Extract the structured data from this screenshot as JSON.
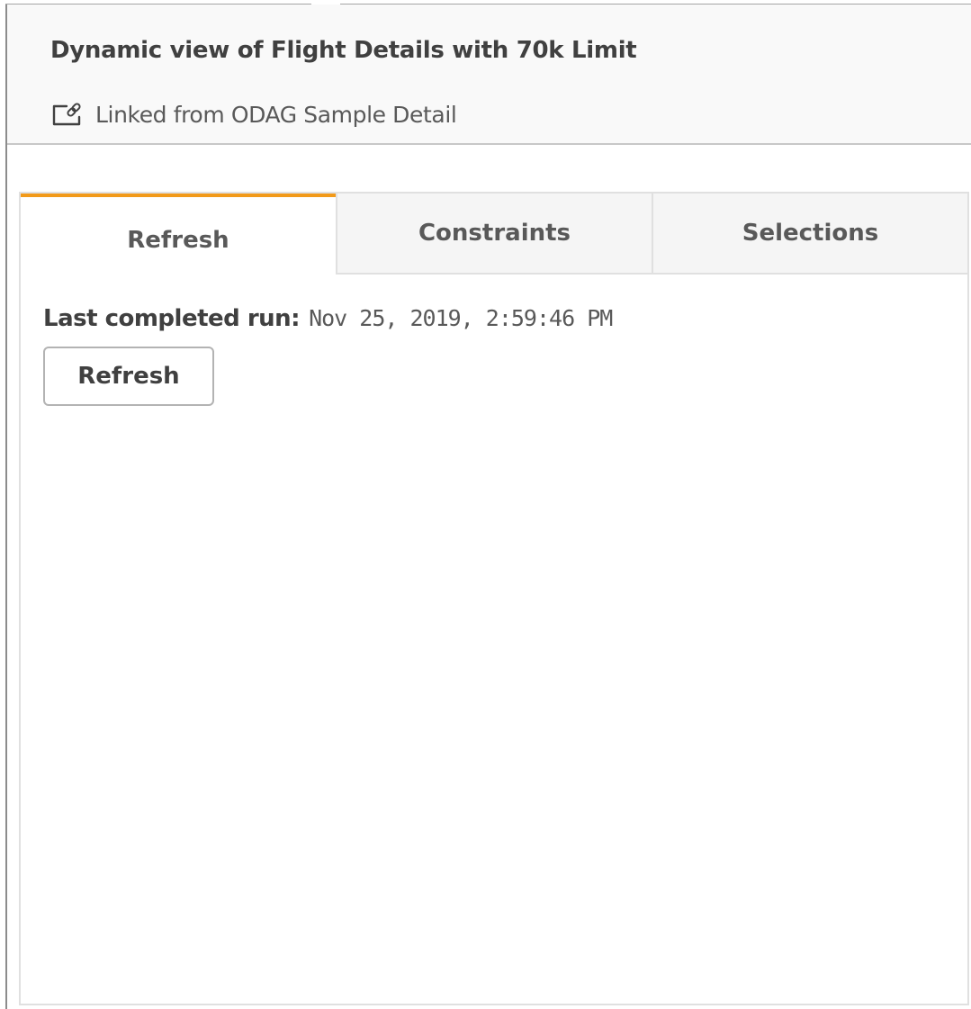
{
  "header": {
    "title": "Dynamic view of Flight Details with 70k Limit",
    "linked_icon": "linked-app-icon",
    "linked_text": "Linked from ODAG Sample Detail"
  },
  "tabs": [
    {
      "label": "Refresh",
      "active": true
    },
    {
      "label": "Constraints",
      "active": false
    },
    {
      "label": "Selections",
      "active": false
    }
  ],
  "refresh_panel": {
    "last_run_label": "Last completed run:",
    "last_run_value": "Nov 25, 2019, 2:59:46 PM",
    "refresh_button_label": "Refresh"
  },
  "colors": {
    "active_tab_accent": "#f29a1a",
    "header_background": "#f9f9f9",
    "inactive_tab_background": "#f5f5f5"
  }
}
